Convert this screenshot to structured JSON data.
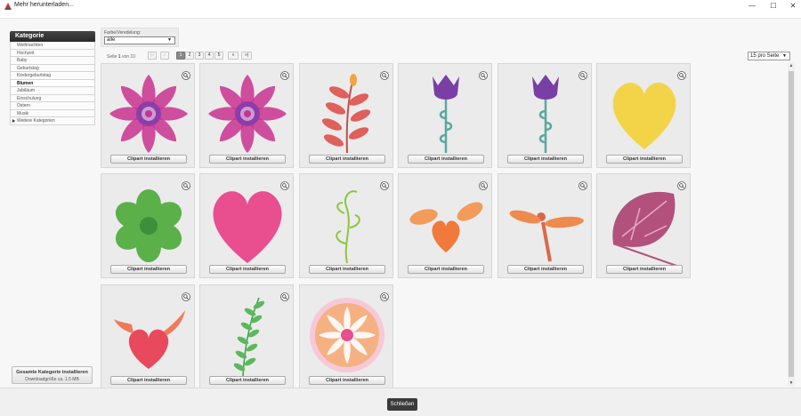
{
  "window": {
    "title": "Mehr herunterladen..."
  },
  "sidebar": {
    "heading": "Kategorie",
    "items": [
      "Weihnachten",
      "Hochzeit",
      "Baby",
      "Geburtstag",
      "Kindergeburtstag",
      "Blumen",
      "Jubiläum",
      "Einschulung",
      "Ostern",
      "Musik",
      "Weitere Kategorien"
    ],
    "active": "Blumen",
    "install_all": {
      "label": "Gesamte Kategorie installieren",
      "size": "Downloadgröße ca. 1.5 MB"
    }
  },
  "filter": {
    "label": "Farbe/Veredelung:",
    "value": "alle"
  },
  "pagination": {
    "prefix": "Seite",
    "current": "1",
    "of": "von 10",
    "pages": [
      "1",
      "2",
      "3",
      "4",
      "5"
    ],
    "first": "|«",
    "prev": "«",
    "next": "»",
    "last": "»|"
  },
  "per_page": {
    "value": "15 pro Seite"
  },
  "tiles": {
    "button_label": "Clipart installieren",
    "items": [
      "mandala-flower",
      "mandala-flower",
      "red-leaf-branch",
      "purple-tulip-spiral",
      "purple-tulip-spiral",
      "yellow-heart",
      "green-flower",
      "pink-heart",
      "green-vine",
      "orange-butterfly-heart",
      "dragonfly",
      "purple-leaf",
      "winged-heart",
      "fern-branch",
      "pink-mandala"
    ]
  },
  "footer": {
    "close_label": "Schließen"
  }
}
